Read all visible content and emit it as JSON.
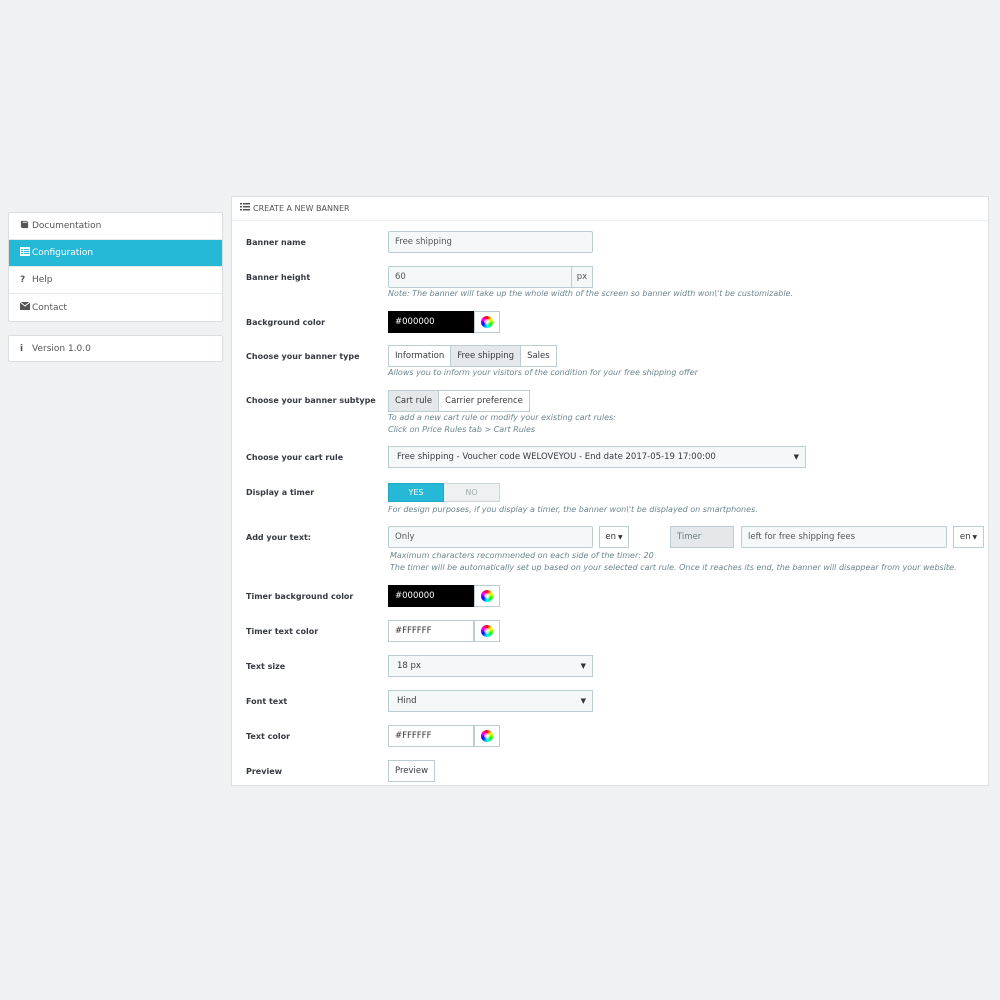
{
  "sidebar": {
    "items": [
      {
        "label": "Documentation",
        "icon": "book-icon"
      },
      {
        "label": "Configuration",
        "icon": "list-icon"
      },
      {
        "label": "Help",
        "icon": "question-icon"
      },
      {
        "label": "Contact",
        "icon": "envelope-icon"
      }
    ],
    "version": "Version 1.0.0"
  },
  "panel": {
    "title": "CREATE A NEW BANNER",
    "banner_name": {
      "label": "Banner name",
      "value": "Free shipping"
    },
    "banner_height": {
      "label": "Banner height",
      "value": "60",
      "unit": "px",
      "help": "Note: The banner will take up the whole width of the screen so banner width won\\'t be customizable."
    },
    "background_color": {
      "label": "Background color",
      "value": "#000000"
    },
    "banner_type": {
      "label": "Choose your banner type",
      "options": [
        "Information",
        "Free shipping",
        "Sales"
      ],
      "selected": "Free shipping",
      "help": "Allows you to inform your visitors of the condition for your free shipping offer"
    },
    "banner_subtype": {
      "label": "Choose your banner subtype",
      "options": [
        "Cart rule",
        "Carrier preference"
      ],
      "selected": "Cart rule",
      "help1": "To add a new cart rule or modify your existing cart rules:",
      "help2": "Click on Price Rules tab > Cart Rules"
    },
    "cart_rule": {
      "label": "Choose your cart rule",
      "value": "Free shipping - Voucher code WELOVEYOU - End date 2017-05-19 17:00:00"
    },
    "display_timer": {
      "label": "Display a timer",
      "yes": "YES",
      "no": "NO",
      "value": "YES",
      "help": "For design purposes, if you display a timer, the banner won\\'t be displayed on smartphones."
    },
    "add_text": {
      "label": "Add your text:",
      "left_value": "Only",
      "left_lang": "en",
      "timer_placeholder": "Timer",
      "right_value": "left for free shipping fees",
      "right_lang": "en",
      "help1": "Maximum characters recommended on each side of the timer: 20",
      "help2": "The timer will be automatically set up based on your selected cart rule. Once it reaches its end, the banner will disappear from your website."
    },
    "timer_bg_color": {
      "label": "Timer background color",
      "value": "#000000"
    },
    "timer_text_color": {
      "label": "Timer text color",
      "value": "#FFFFFF"
    },
    "text_size": {
      "label": "Text size",
      "value": "18 px"
    },
    "font_text": {
      "label": "Font text",
      "value": "Hind"
    },
    "text_color": {
      "label": "Text color",
      "value": "#FFFFFF"
    },
    "preview": {
      "label": "Preview",
      "button": "Preview"
    }
  },
  "colors": {
    "accent": "#25b9d7",
    "page_bg": "#eff1f2"
  }
}
